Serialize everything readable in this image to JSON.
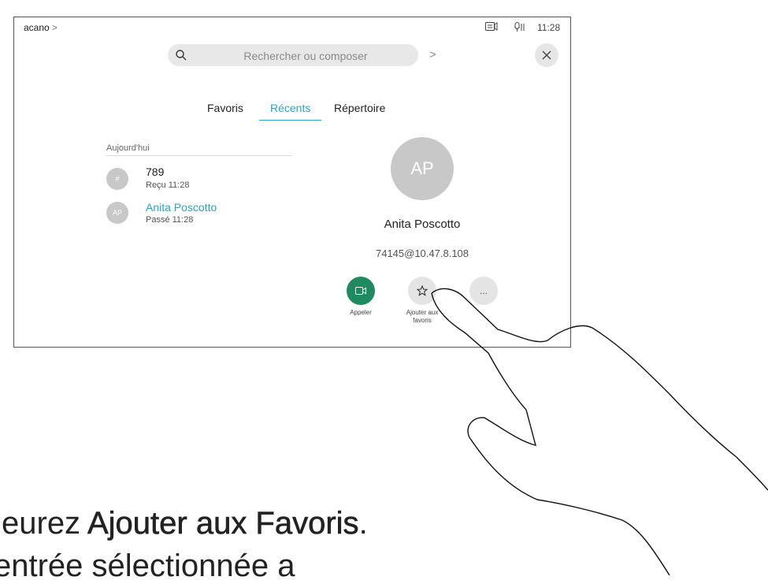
{
  "header": {
    "brand": "acano",
    "brand_chevron": ">",
    "time": "11:28",
    "icons": [
      "share-screen-icon",
      "microphone-icon"
    ]
  },
  "search": {
    "placeholder": "Rechercher ou composer",
    "forward_chevron": ">"
  },
  "close_icon": "×",
  "tabs": [
    {
      "label": "Favoris",
      "active": false
    },
    {
      "label": "Récents",
      "active": true
    },
    {
      "label": "Répertoire",
      "active": false
    }
  ],
  "recents": {
    "section_label": "Aujourd'hui",
    "items": [
      {
        "avatar": "#",
        "name": "789",
        "detail": "Reçu 11:28",
        "selected": false
      },
      {
        "avatar": "AP",
        "name": "Anita Poscotto",
        "detail": "Passé 11:28",
        "selected": true
      }
    ]
  },
  "contact": {
    "initials": "AP",
    "name": "Anita Poscotto",
    "address": "74145@10.47.8.108",
    "actions": [
      {
        "label": "Appeler",
        "icon": "video-camera-icon"
      },
      {
        "label_line1": "Ajouter aux",
        "label_line2": "favoris",
        "icon": "star-icon"
      },
      {
        "label": "...",
        "icon": "more-icon"
      }
    ]
  },
  "caption": {
    "line1_prefix": "fleurez ",
    "line1_bold": "Ajouter aux Favoris",
    "line1_suffix": ".",
    "line2": "entrée sélectionnée a"
  },
  "colors": {
    "accent": "#2aa3c9",
    "call_green": "#1f8a5f",
    "avatar_gray": "#c8c8c8"
  }
}
